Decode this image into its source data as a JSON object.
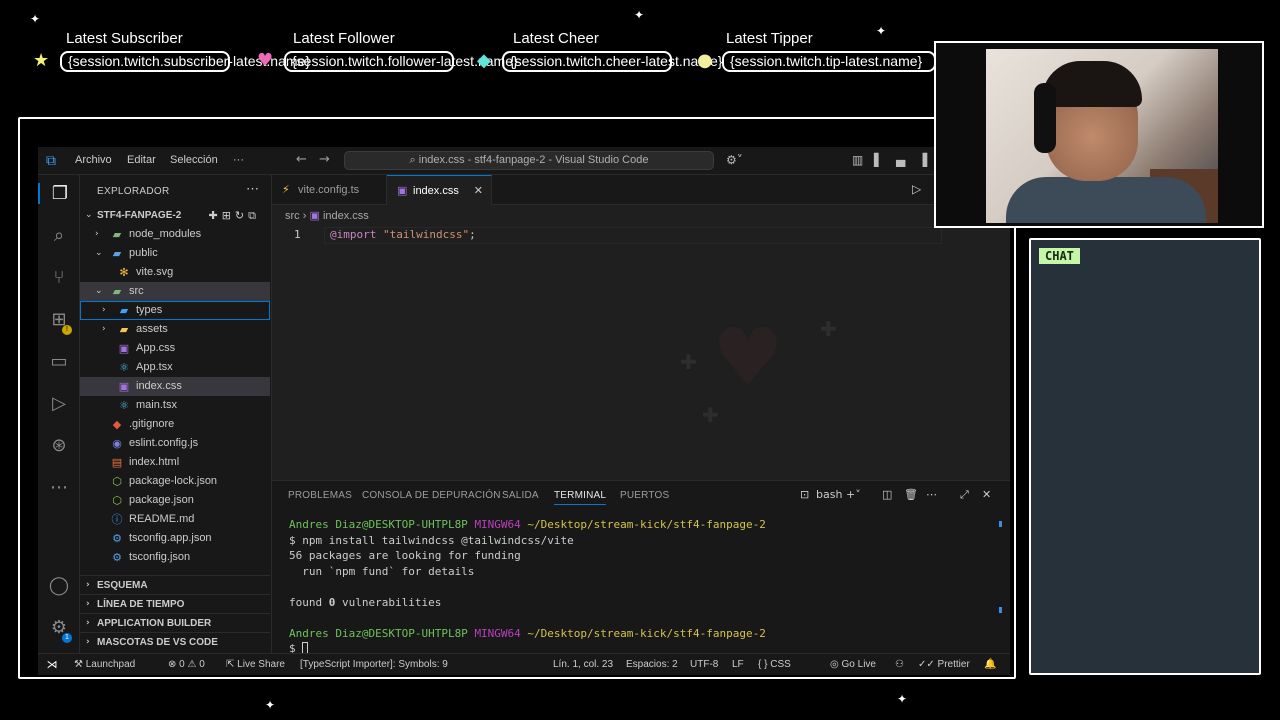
{
  "overlay": {
    "alerts": [
      {
        "label": "Latest Subscriber",
        "value": "{session.twitch.subscriber-latest.name}",
        "icon": "star-icon"
      },
      {
        "label": "Latest Follower",
        "value": "{session.twitch.follower-latest.name}",
        "icon": "heart-icon"
      },
      {
        "label": "Latest Cheer",
        "value": "{session.twitch.cheer-latest.name}",
        "icon": "gem-icon"
      },
      {
        "label": "Latest Tipper",
        "value": "{session.twitch.tip-latest.name}",
        "icon": "coin-icon"
      }
    ],
    "chat_label": "CHAT"
  },
  "vscode": {
    "menu": [
      "Archivo",
      "Editar",
      "Selección",
      "···"
    ],
    "search_text": "index.css - stf4-fanpage-2 - Visual Studio Code",
    "explorer_title": "EXPLORADOR",
    "project_name": "STF4-FANPAGE-2",
    "tree": [
      {
        "name": "node_modules",
        "icon": "folder-icon"
      },
      {
        "name": "public",
        "icon": "folder-open-icon"
      },
      {
        "name": "vite.svg",
        "icon": "svg-file-icon"
      },
      {
        "name": "src",
        "icon": "folder-open-icon"
      },
      {
        "name": "types",
        "icon": "folder-icon"
      },
      {
        "name": "assets",
        "icon": "folder-icon"
      },
      {
        "name": "App.css",
        "icon": "css-file-icon"
      },
      {
        "name": "App.tsx",
        "icon": "react-file-icon"
      },
      {
        "name": "index.css",
        "icon": "css-file-icon"
      },
      {
        "name": "main.tsx",
        "icon": "react-file-icon"
      },
      {
        "name": ".gitignore",
        "icon": "git-file-icon"
      },
      {
        "name": "eslint.config.js",
        "icon": "eslint-file-icon"
      },
      {
        "name": "index.html",
        "icon": "html-file-icon"
      },
      {
        "name": "package-lock.json",
        "icon": "json-file-icon"
      },
      {
        "name": "package.json",
        "icon": "json-file-icon"
      },
      {
        "name": "README.md",
        "icon": "info-file-icon"
      },
      {
        "name": "tsconfig.app.json",
        "icon": "ts-config-icon"
      },
      {
        "name": "tsconfig.json",
        "icon": "ts-config-icon"
      }
    ],
    "sections": [
      "ESQUEMA",
      "LÍNEA DE TIEMPO",
      "APPLICATION BUILDER",
      "MASCOTAS DE VS CODE"
    ],
    "tabs": [
      {
        "label": "vite.config.ts",
        "active": false
      },
      {
        "label": "index.css",
        "active": true
      }
    ],
    "breadcrumb": [
      "src",
      "index.css"
    ],
    "code": {
      "line_number": "1",
      "keyword": "@import",
      "string": "\"tailwindcss\"",
      "end": ";"
    },
    "panel_tabs": [
      "PROBLEMAS",
      "CONSOLA DE DEPURACIÓN",
      "SALIDA",
      "TERMINAL",
      "PUERTOS"
    ],
    "terminal_shell": "bash",
    "terminal": {
      "user": "Andres Diaz@DESKTOP-UHTPL8P",
      "env": "MINGW64",
      "path": "~/Desktop/stream-kick/stf4-fanpage-2",
      "cmd": "$ npm install tailwindcss @tailwindcss/vite",
      "out1": "56 packages are looking for funding",
      "out2": "  run `npm fund` for details",
      "out3a": "found ",
      "out3b": "0",
      "out3c": " vulnerabilities",
      "prompt": "$ "
    },
    "status": {
      "launchpad": "Launchpad",
      "problems": "⊗ 0 ⚠ 0",
      "liveshare": "Live Share",
      "ts": "[TypeScript Importer]: Symbols: 9",
      "position": "Lín. 1, col. 23",
      "spaces": "Espacios: 2",
      "encoding": "UTF-8",
      "eol": "LF",
      "lang": "{ } CSS",
      "golive": "Go Live",
      "prettier": "Prettier"
    }
  },
  "colors": {
    "accent": "#0078d4",
    "chat_badge": "#c5f7a8",
    "chat_bg": "#26313a"
  }
}
